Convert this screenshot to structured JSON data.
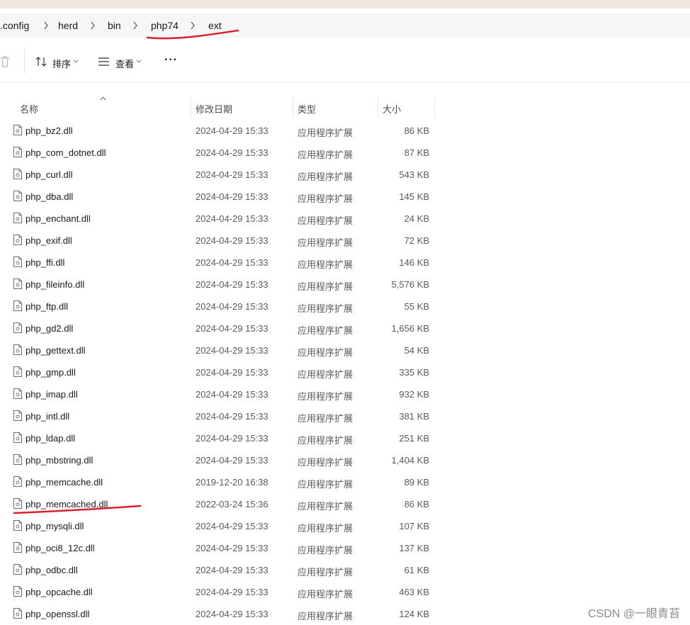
{
  "breadcrumb": {
    "items": [
      ".config",
      "herd",
      "bin",
      "php74",
      "ext"
    ]
  },
  "toolbar": {
    "sort_label": "排序",
    "view_label": "查看",
    "more_label": "···"
  },
  "columns": {
    "name": "名称",
    "date": "修改日期",
    "type": "类型",
    "size": "大小"
  },
  "files": [
    {
      "name": "php_bz2.dll",
      "date": "2024-04-29 15:33",
      "type": "应用程序扩展",
      "size": "86 KB"
    },
    {
      "name": "php_com_dotnet.dll",
      "date": "2024-04-29 15:33",
      "type": "应用程序扩展",
      "size": "87 KB"
    },
    {
      "name": "php_curl.dll",
      "date": "2024-04-29 15:33",
      "type": "应用程序扩展",
      "size": "543 KB"
    },
    {
      "name": "php_dba.dll",
      "date": "2024-04-29 15:33",
      "type": "应用程序扩展",
      "size": "145 KB"
    },
    {
      "name": "php_enchant.dll",
      "date": "2024-04-29 15:33",
      "type": "应用程序扩展",
      "size": "24 KB"
    },
    {
      "name": "php_exif.dll",
      "date": "2024-04-29 15:33",
      "type": "应用程序扩展",
      "size": "72 KB"
    },
    {
      "name": "php_ffi.dll",
      "date": "2024-04-29 15:33",
      "type": "应用程序扩展",
      "size": "146 KB"
    },
    {
      "name": "php_fileinfo.dll",
      "date": "2024-04-29 15:33",
      "type": "应用程序扩展",
      "size": "5,576 KB"
    },
    {
      "name": "php_ftp.dll",
      "date": "2024-04-29 15:33",
      "type": "应用程序扩展",
      "size": "55 KB"
    },
    {
      "name": "php_gd2.dll",
      "date": "2024-04-29 15:33",
      "type": "应用程序扩展",
      "size": "1,656 KB"
    },
    {
      "name": "php_gettext.dll",
      "date": "2024-04-29 15:33",
      "type": "应用程序扩展",
      "size": "54 KB"
    },
    {
      "name": "php_gmp.dll",
      "date": "2024-04-29 15:33",
      "type": "应用程序扩展",
      "size": "335 KB"
    },
    {
      "name": "php_imap.dll",
      "date": "2024-04-29 15:33",
      "type": "应用程序扩展",
      "size": "932 KB"
    },
    {
      "name": "php_intl.dll",
      "date": "2024-04-29 15:33",
      "type": "应用程序扩展",
      "size": "381 KB"
    },
    {
      "name": "php_ldap.dll",
      "date": "2024-04-29 15:33",
      "type": "应用程序扩展",
      "size": "251 KB"
    },
    {
      "name": "php_mbstring.dll",
      "date": "2024-04-29 15:33",
      "type": "应用程序扩展",
      "size": "1,404 KB"
    },
    {
      "name": "php_memcache.dll",
      "date": "2019-12-20 16:38",
      "type": "应用程序扩展",
      "size": "89 KB"
    },
    {
      "name": "php_memcached.dll",
      "date": "2022-03-24 15:36",
      "type": "应用程序扩展",
      "size": "86 KB"
    },
    {
      "name": "php_mysqli.dll",
      "date": "2024-04-29 15:33",
      "type": "应用程序扩展",
      "size": "107 KB"
    },
    {
      "name": "php_oci8_12c.dll",
      "date": "2024-04-29 15:33",
      "type": "应用程序扩展",
      "size": "137 KB"
    },
    {
      "name": "php_odbc.dll",
      "date": "2024-04-29 15:33",
      "type": "应用程序扩展",
      "size": "61 KB"
    },
    {
      "name": "php_opcache.dll",
      "date": "2024-04-29 15:33",
      "type": "应用程序扩展",
      "size": "463 KB"
    },
    {
      "name": "php_openssl.dll",
      "date": "2024-04-29 15:33",
      "type": "应用程序扩展",
      "size": "124 KB"
    }
  ],
  "watermark": "CSDN @一眼青苔",
  "annotation_color": "#d9202b"
}
